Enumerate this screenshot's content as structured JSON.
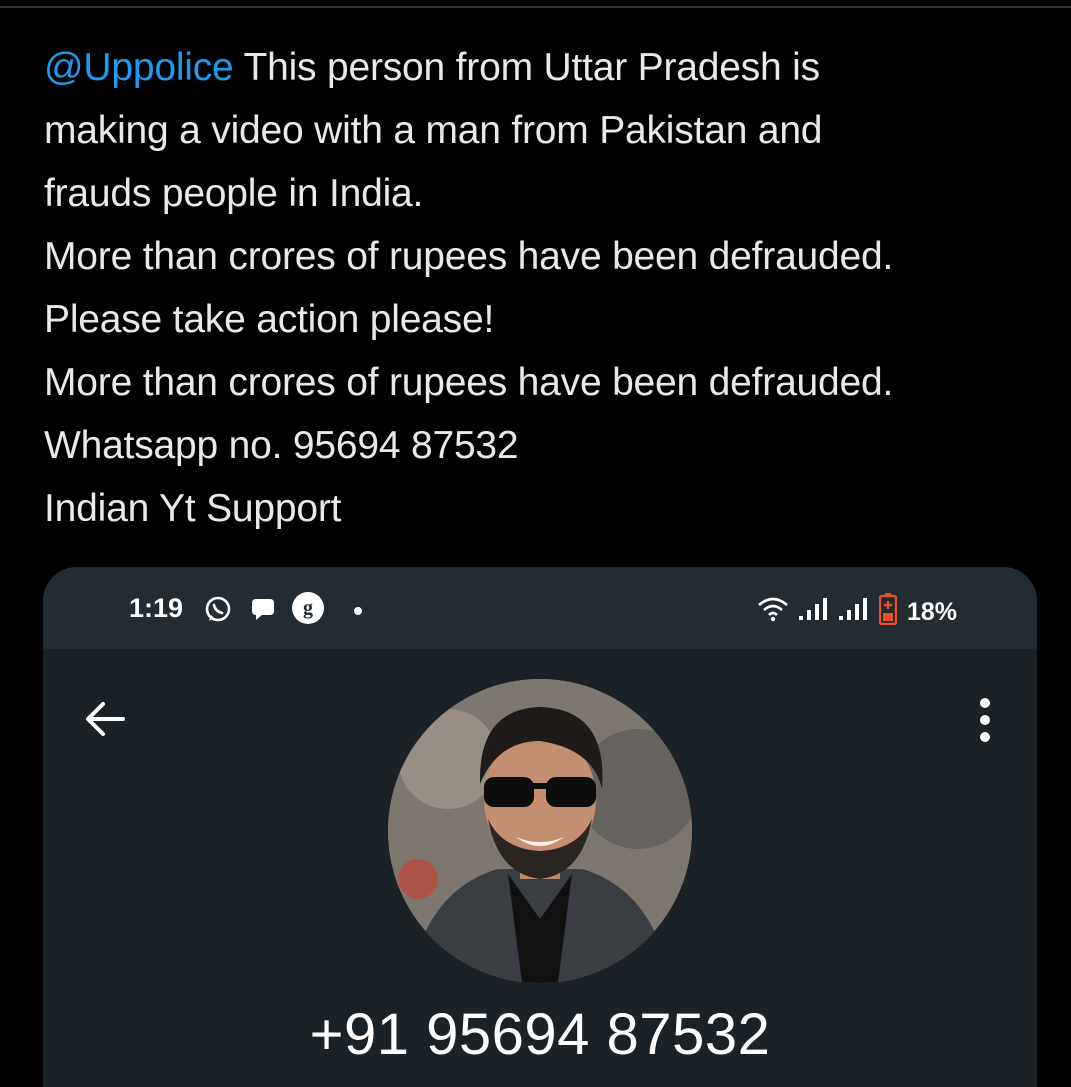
{
  "tweet": {
    "mention": "@Uppolice",
    "line1_rest": " This person from Uttar Pradesh is",
    "line2": "making a video with a man from Pakistan and",
    "line3": "frauds people in India.",
    "line4": "More than crores of rupees have been defrauded.",
    "line5": "Please take action please!",
    "line6": "More than crores of rupees have been defrauded.",
    "line7": "Whatsapp no. 95694 87532",
    "line8": "Indian Yt Support"
  },
  "screenshot": {
    "status_bar": {
      "time": "1:19",
      "battery": "18%",
      "icons": [
        "whatsapp-icon",
        "chat-bubble-icon",
        "g-circle-icon",
        "dot-icon",
        "wifi-icon",
        "signal-icon",
        "signal-icon",
        "battery-low-icon"
      ]
    },
    "contact": {
      "phone_number": "+91 95694 87532"
    }
  }
}
